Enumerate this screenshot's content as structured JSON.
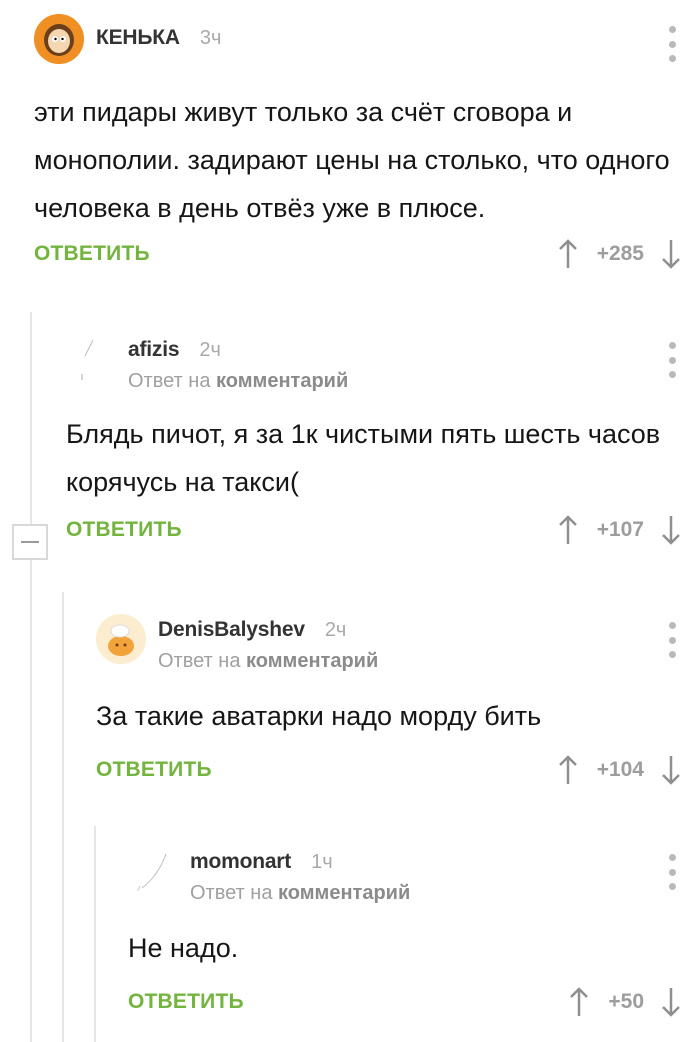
{
  "reply_label": "ОТВЕТИТЬ",
  "reply_prefix": "Ответ на",
  "reply_target": "комментарий",
  "comments": [
    {
      "username": "КЕНЬКА",
      "time": "3ч",
      "text": "эти пидары живут только за счёт сговора и монополии. задирают цены на столько, что одного человека в день отвёз уже в плюсе.",
      "score": "+285"
    },
    {
      "username": "afizis",
      "time": "2ч",
      "text": "Блядь пичот, я за 1к чистыми пять шесть часов корячусь на такси(",
      "score": "+107"
    },
    {
      "username": "DenisBalyshev",
      "time": "2ч",
      "text": "За такие аватарки надо морду бить",
      "score": "+104"
    },
    {
      "username": "momonart",
      "time": "1ч",
      "text": "Не надо.",
      "score": "+50"
    }
  ],
  "icons": {
    "more": "more-vertical-icon",
    "upvote": "arrow-up-icon",
    "downvote": "arrow-down-icon",
    "collapse": "minus-icon"
  },
  "colors": {
    "accent_green": "#73b43e",
    "thread_line": "#e6e6e6",
    "muted_text": "#a0a0a0"
  }
}
